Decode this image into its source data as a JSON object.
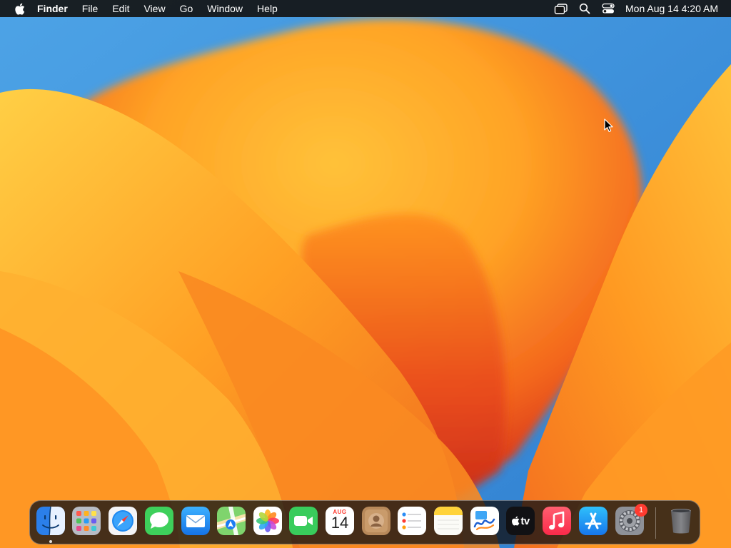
{
  "menubar": {
    "apple_icon": "apple-logo-icon",
    "app_name": "Finder",
    "menus": [
      "File",
      "Edit",
      "View",
      "Go",
      "Window",
      "Help"
    ],
    "status_icons": [
      "screen-mirroring-icon",
      "spotlight-search-icon",
      "control-center-icon"
    ],
    "clock": "Mon Aug 14  4:20 AM"
  },
  "desktop": {
    "wallpaper": "macOS Ventura orange wallpaper",
    "colors": {
      "sky": "#3b8fd8",
      "petal_light": "#ffc93a",
      "petal_mid": "#ff9a1f",
      "petal_dark": "#e2451c"
    }
  },
  "dock": {
    "apps": [
      {
        "name": "Finder",
        "icon": "finder-icon",
        "running": true
      },
      {
        "name": "Launchpad",
        "icon": "launchpad-icon",
        "running": false
      },
      {
        "name": "Safari",
        "icon": "safari-icon",
        "running": false
      },
      {
        "name": "Messages",
        "icon": "messages-icon",
        "running": false
      },
      {
        "name": "Mail",
        "icon": "mail-icon",
        "running": false
      },
      {
        "name": "Maps",
        "icon": "maps-icon",
        "running": false
      },
      {
        "name": "Photos",
        "icon": "photos-icon",
        "running": false
      },
      {
        "name": "FaceTime",
        "icon": "facetime-icon",
        "running": false
      },
      {
        "name": "Calendar",
        "icon": "calendar-icon",
        "running": false,
        "month": "AUG",
        "day": "14"
      },
      {
        "name": "Contacts",
        "icon": "contacts-icon",
        "running": false
      },
      {
        "name": "Reminders",
        "icon": "reminders-icon",
        "running": false
      },
      {
        "name": "Notes",
        "icon": "notes-icon",
        "running": false
      },
      {
        "name": "Freeform",
        "icon": "freeform-icon",
        "running": false
      },
      {
        "name": "TV",
        "icon": "apple-tv-icon",
        "running": false,
        "label": "tv"
      },
      {
        "name": "Music",
        "icon": "music-icon",
        "running": false
      },
      {
        "name": "App Store",
        "icon": "app-store-icon",
        "running": false
      },
      {
        "name": "System Settings",
        "icon": "system-settings-icon",
        "running": false,
        "badge": "1"
      }
    ],
    "trash": {
      "name": "Trash",
      "icon": "trash-icon"
    }
  }
}
